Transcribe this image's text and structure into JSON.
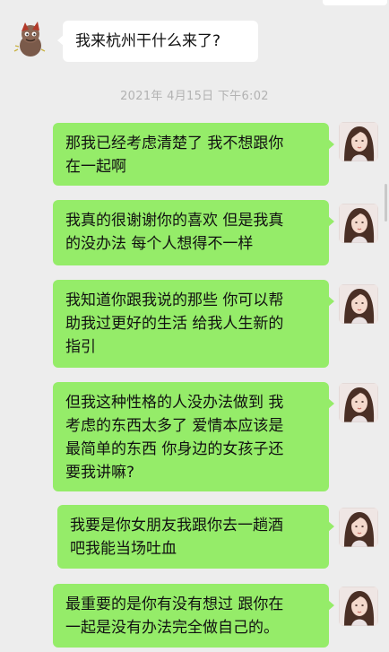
{
  "timestamp": "2021年 4月15日 下午6:02",
  "messages": [
    {
      "side": "received",
      "text": "我来杭州干什么来了?"
    },
    {
      "side": "sent",
      "text": "那我已经考虑清楚了 我不想跟你\n在一起啊"
    },
    {
      "side": "sent",
      "text": "我真的很谢谢你的喜欢 但是我真\n的没办法 每个人想得不一样"
    },
    {
      "side": "sent",
      "text": "我知道你跟我说的那些 你可以帮\n助我过更好的生活 给我人生新的\n指引"
    },
    {
      "side": "sent",
      "text": "但我这种性格的人没办法做到 我\n考虑的东西太多了 爱情本应该是\n最简单的东西 你身边的女孩子还\n要我讲嘛?"
    },
    {
      "side": "sent",
      "text": "我要是你女朋友我跟你去一趟酒\n吧我能当场吐血"
    },
    {
      "side": "sent",
      "text": "最重要的是你有没有想过 跟你在\n一起是没有办法完全做自己的。"
    }
  ],
  "colors": {
    "background": "#ededed",
    "sent_bubble": "#95ec69",
    "received_bubble": "#ffffff",
    "timestamp_text": "#b2b2b2"
  },
  "icons": {
    "contact_avatar": "cartoon-character-avatar",
    "self_avatar": "woman-portrait-avatar"
  }
}
